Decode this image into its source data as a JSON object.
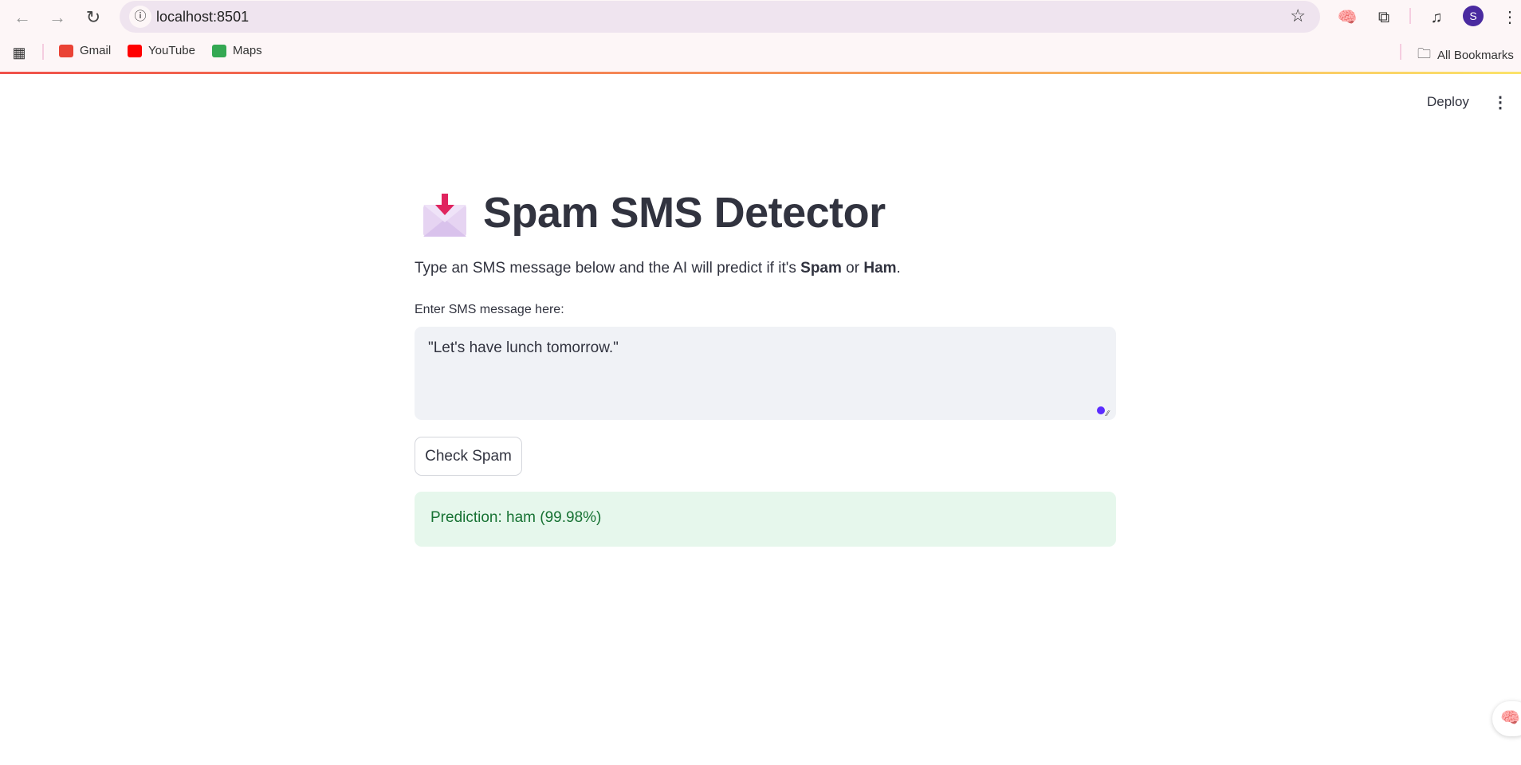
{
  "browser": {
    "url": "localhost:8501",
    "bookmarks": [
      {
        "label": "Gmail",
        "color": "#ea4335"
      },
      {
        "label": "YouTube",
        "color": "#ff0000"
      },
      {
        "label": "Maps",
        "color": "#34a853"
      }
    ],
    "all_bookmarks": "All Bookmarks",
    "profile_initial": "S"
  },
  "header": {
    "deploy": "Deploy"
  },
  "main": {
    "title": "Spam SMS Detector",
    "description_prefix": "Type an SMS message below and the AI will predict if it's ",
    "description_spam": "Spam",
    "description_or": " or ",
    "description_ham": "Ham",
    "description_suffix": ".",
    "input_label": "Enter SMS message here:",
    "input_value": "\"Let's have lunch tomorrow.\"",
    "button": "Check Spam",
    "prediction": "Prediction: ham (99.98%)"
  },
  "colors": {
    "success_bg": "#e6f7ec",
    "success_text": "#177233",
    "accent": "#5b2cff"
  }
}
